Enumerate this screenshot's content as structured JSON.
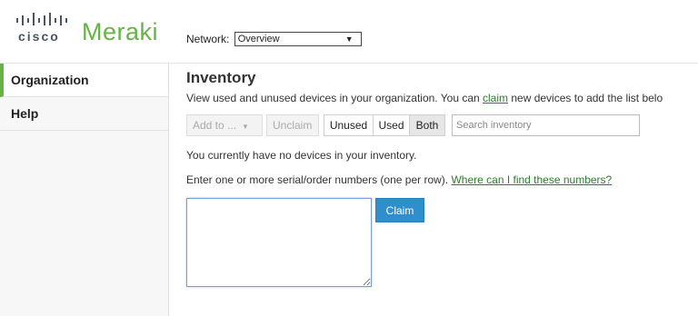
{
  "header": {
    "logo_cisco": "cisco",
    "logo_meraki": "Meraki",
    "network_label": "Network:",
    "network_selected": "Overview"
  },
  "sidebar": {
    "items": [
      {
        "label": "Organization",
        "active": true
      },
      {
        "label": "Help",
        "active": false
      }
    ]
  },
  "main": {
    "title": "Inventory",
    "subtitle_pre": "View used and unused devices in your organization. You can ",
    "subtitle_link": "claim",
    "subtitle_post": " new devices to add the list belo",
    "toolbar": {
      "add_to_label": "Add to ...",
      "unclaim_label": "Unclaim",
      "filter_unused": "Unused",
      "filter_used": "Used",
      "filter_both": "Both",
      "filter_selected": "Both",
      "search_placeholder": "Search inventory"
    },
    "no_devices_text": "You currently have no devices in your inventory.",
    "enter_text": "Enter one or more serial/order numbers (one per row). ",
    "enter_link": "Where can I find these numbers?",
    "serials_value": "",
    "claim_button": "Claim"
  },
  "colors": {
    "brand_green": "#67b346",
    "link_green": "#2d7d2d",
    "claim_blue": "#2f8fcc"
  }
}
